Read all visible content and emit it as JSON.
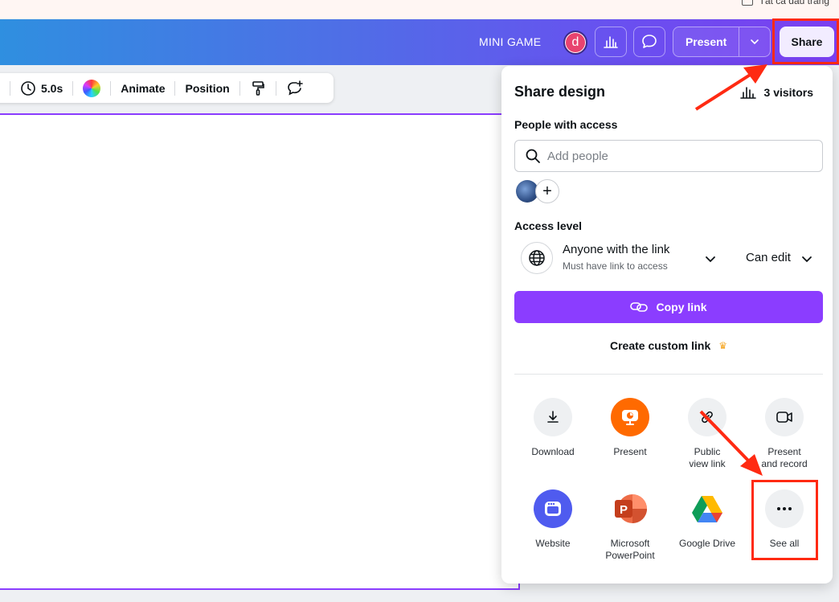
{
  "bookmarks": {
    "label": "Tất cả dấu trang"
  },
  "topbar": {
    "project_title": "MINI GAME",
    "avatar_letter": "d",
    "present_label": "Present",
    "share_label": "Share"
  },
  "context_toolbar": {
    "duration": "5.0s",
    "animate": "Animate",
    "position": "Position"
  },
  "share_panel": {
    "title": "Share design",
    "visitors": "3 visitors",
    "people_label": "People with access",
    "add_people_placeholder": "Add people",
    "access_label": "Access level",
    "access_value": "Anyone with the link",
    "access_sub": "Must have link to access",
    "permission": "Can edit",
    "copy_link": "Copy link",
    "custom_link": "Create custom link",
    "options": [
      {
        "label": "Download",
        "icon": "download-icon"
      },
      {
        "label": "Present",
        "icon": "present-icon"
      },
      {
        "label": "Public view link",
        "line1": "Public",
        "line2": "view link",
        "icon": "link-icon"
      },
      {
        "label": "Present and record",
        "line1": "Present",
        "line2": "and record",
        "icon": "video-icon"
      },
      {
        "label": "Website",
        "icon": "website-icon"
      },
      {
        "label": "Microsoft PowerPoint",
        "line1": "Microsoft",
        "line2": "PowerPoint",
        "icon": "powerpoint-icon"
      },
      {
        "label": "Google Drive",
        "icon": "google-drive-icon"
      },
      {
        "label": "See all",
        "icon": "more-icon"
      }
    ]
  },
  "colors": {
    "accent": "#8b3dff",
    "annotation_red": "#ff2a12"
  }
}
